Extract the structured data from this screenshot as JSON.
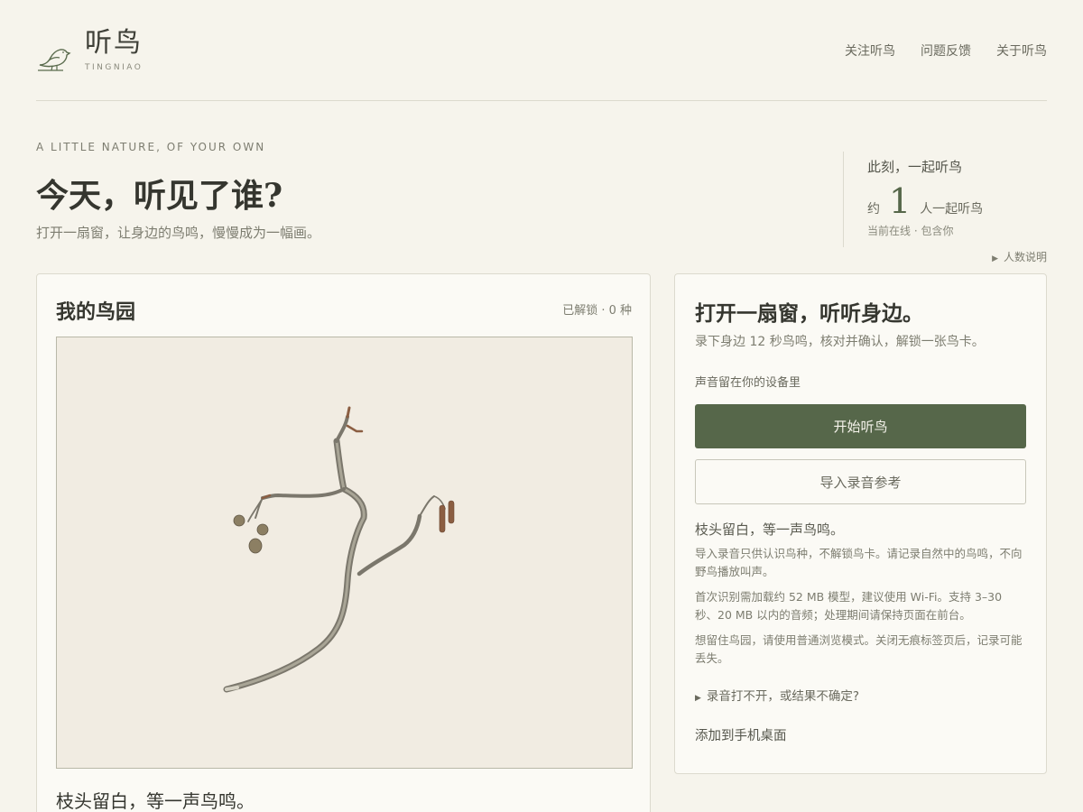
{
  "brand": {
    "title": "听鸟",
    "subtitle": "TINGNIAO",
    "logo_icon": "bird-icon"
  },
  "nav": {
    "items": [
      {
        "label": "关注听鸟"
      },
      {
        "label": "问题反馈"
      },
      {
        "label": "关于听鸟"
      }
    ]
  },
  "hero": {
    "eyebrow": "A LITTLE NATURE, OF YOUR OWN",
    "title": "今天，听见了谁?",
    "subtitle": "打开一扇窗，让身边的鸟鸣，慢慢成为一幅画。"
  },
  "online": {
    "heading": "此刻，一起听鸟",
    "prefix": "约",
    "count": "1",
    "suffix": "人一起听鸟",
    "note": "当前在线 · 包含你",
    "help_label": "人数说明"
  },
  "garden": {
    "title": "我的鸟园",
    "meta": "已解锁 · 0 种",
    "image_subject": "branch-illustration",
    "caption": "枝头留白，等一声鸟鸣。"
  },
  "listen": {
    "title": "打开一扇窗，听听身边。",
    "subtitle": "录下身边 12 秒鸟鸣，核对并确认，解锁一张鸟卡。",
    "privacy": "声音留在你的设备里",
    "primary_button": "开始听鸟",
    "secondary_button": "导入录音参考",
    "hint": "枝头留白，等一声鸟鸣。",
    "notes": [
      "导入录音只供认识鸟种，不解锁鸟卡。请记录自然中的鸟鸣，不向野鸟播放叫声。",
      "首次识别需加载约 52 MB 模型，建议使用 Wi-Fi。支持 3–30 秒、20 MB 以内的音频；处理期间请保持页面在前台。",
      "想留住鸟园，请使用普通浏览模式。关闭无痕标签页后，记录可能丢失。"
    ],
    "trouble_label": "录音打不开，或结果不确定?",
    "add_home_label": "添加到手机桌面"
  },
  "colors": {
    "background": "#f6f4ec",
    "accent": "#56674a",
    "card": "#fbfaf5",
    "border": "#dcdace"
  }
}
